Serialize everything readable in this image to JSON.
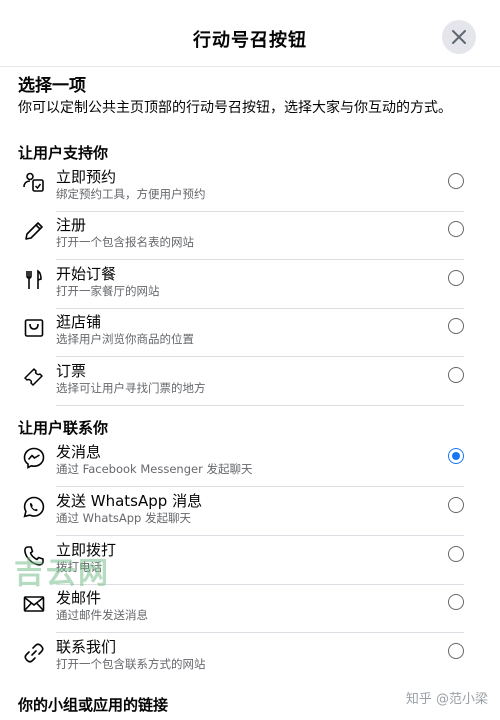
{
  "header": {
    "title": "行动号召按钮",
    "close_icon": "close-icon"
  },
  "intro": {
    "heading": "选择一项",
    "description": "你可以定制公共主页顶部的行动号召按钮，选择大家与你互动的方式。"
  },
  "sections": [
    {
      "title": "让用户支持你",
      "items": [
        {
          "icon": "calendar-person-icon",
          "label": "立即预约",
          "sub": "绑定预约工具，方便用户预约",
          "selected": false
        },
        {
          "icon": "pencil-icon",
          "label": "注册",
          "sub": "打开一个包含报名表的网站",
          "selected": false
        },
        {
          "icon": "utensils-icon",
          "label": "开始订餐",
          "sub": "打开一家餐厅的网站",
          "selected": false
        },
        {
          "icon": "shopping-bag-icon",
          "label": "逛店铺",
          "sub": "选择用户浏览你商品的位置",
          "selected": false
        },
        {
          "icon": "ticket-icon",
          "label": "订票",
          "sub": "选择可让用户寻找门票的地方",
          "selected": false
        }
      ]
    },
    {
      "title": "让用户联系你",
      "items": [
        {
          "icon": "messenger-icon",
          "label": "发消息",
          "sub": "通过 Facebook Messenger 发起聊天",
          "selected": true
        },
        {
          "icon": "whatsapp-icon",
          "label": "发送 WhatsApp 消息",
          "sub": "通过 WhatsApp 发起聊天",
          "selected": false
        },
        {
          "icon": "phone-icon",
          "label": "立即拨打",
          "sub": "拨打电话",
          "selected": false
        },
        {
          "icon": "envelope-icon",
          "label": "发邮件",
          "sub": "通过邮件发送消息",
          "selected": false
        },
        {
          "icon": "link-icon",
          "label": "联系我们",
          "sub": "打开一个包含联系方式的网站",
          "selected": false
        }
      ]
    },
    {
      "title": "你的小组或应用的链接",
      "items": []
    }
  ],
  "overlay": {
    "watermark": "吉云网",
    "credit": "知乎 @范小梁"
  },
  "colors": {
    "accent": "#1877f2",
    "secondary_text": "#65676b",
    "divider": "#dadde1"
  }
}
